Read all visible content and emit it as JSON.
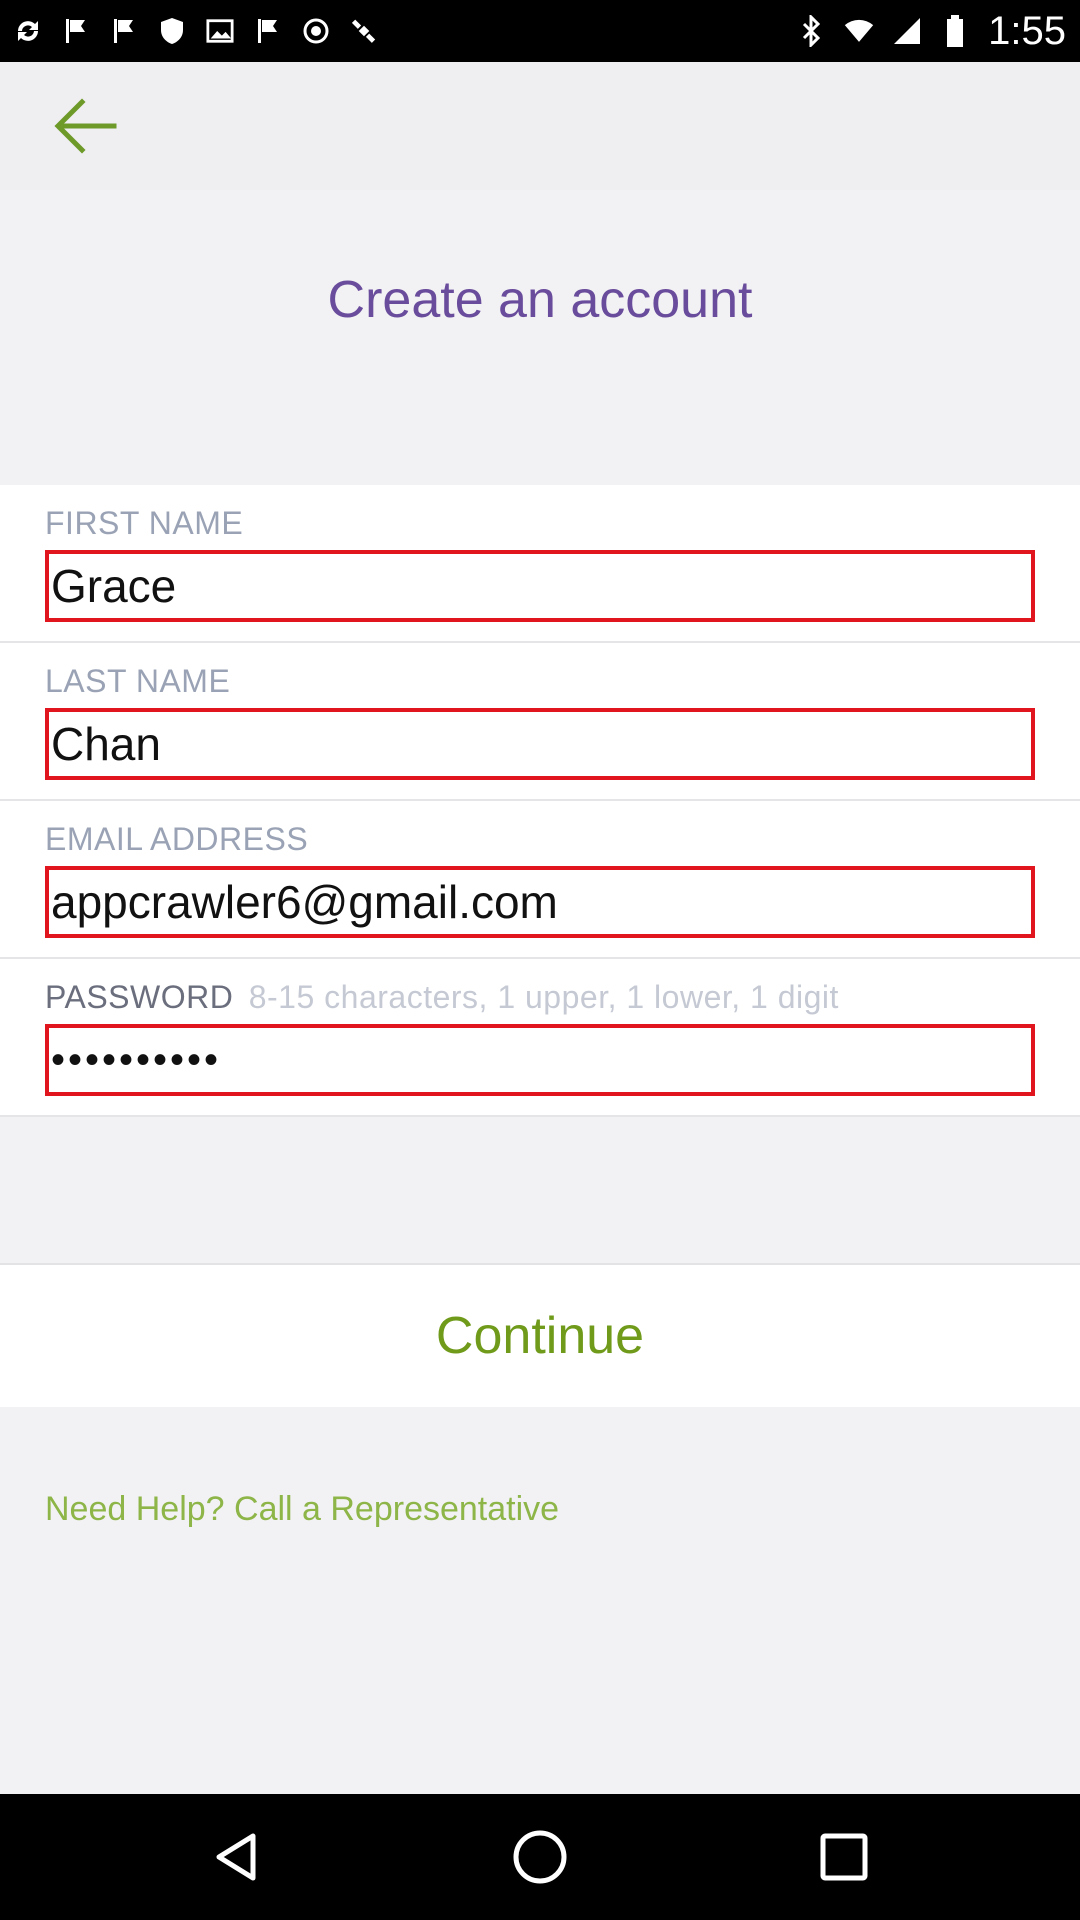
{
  "status_bar": {
    "time": "1:55",
    "left_icons": [
      "sync-icon",
      "flag-icon",
      "flag-icon",
      "shield-icon",
      "image-icon",
      "flag-icon",
      "record-icon",
      "satellite-icon"
    ],
    "right_icons": [
      "bluetooth-icon",
      "wifi-icon",
      "signal-icon",
      "battery-icon"
    ]
  },
  "header": {
    "title": "Create an account",
    "accent_color": "#6a4c9c"
  },
  "form": {
    "first_name": {
      "label": "FIRST NAME",
      "value": "Grace"
    },
    "last_name": {
      "label": "LAST NAME",
      "value": "Chan"
    },
    "email": {
      "label": "EMAIL ADDRESS",
      "value": "appcrawler6@gmail.com"
    },
    "password": {
      "label": "PASSWORD",
      "hint": "8-15 characters, 1 upper, 1 lower, 1 digit",
      "value": "••••••••••"
    },
    "error_border_color": "#e0151d"
  },
  "actions": {
    "continue_label": "Continue",
    "help_link": "Need Help? Call a Representative",
    "action_color": "#6f9a1a"
  }
}
